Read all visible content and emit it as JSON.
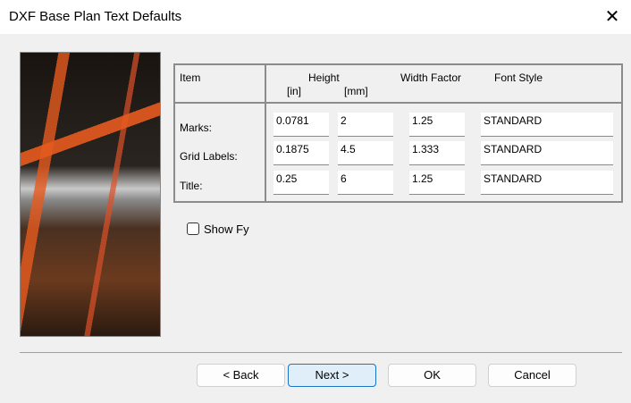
{
  "window": {
    "title": "DXF Base Plan Text Defaults",
    "close_icon": "close-icon"
  },
  "table": {
    "headers": {
      "item": "Item",
      "height": "Height",
      "in": "[in]",
      "mm": "[mm]",
      "width_factor": "Width Factor",
      "font_style": "Font Style"
    },
    "rows": [
      {
        "label": "Marks:",
        "in": "0.0781",
        "mm": "2",
        "width_factor": "1.25",
        "font_style": "STANDARD"
      },
      {
        "label": "Grid Labels:",
        "in": "0.1875",
        "mm": "4.5",
        "width_factor": "1.333",
        "font_style": "STANDARD"
      },
      {
        "label": "Title:",
        "in": "0.25",
        "mm": "6",
        "width_factor": "1.25",
        "font_style": "STANDARD"
      }
    ]
  },
  "show_fy": {
    "label": "Show Fy",
    "checked": false
  },
  "buttons": {
    "back": "< Back",
    "next": "Next >",
    "ok": "OK",
    "cancel": "Cancel"
  }
}
